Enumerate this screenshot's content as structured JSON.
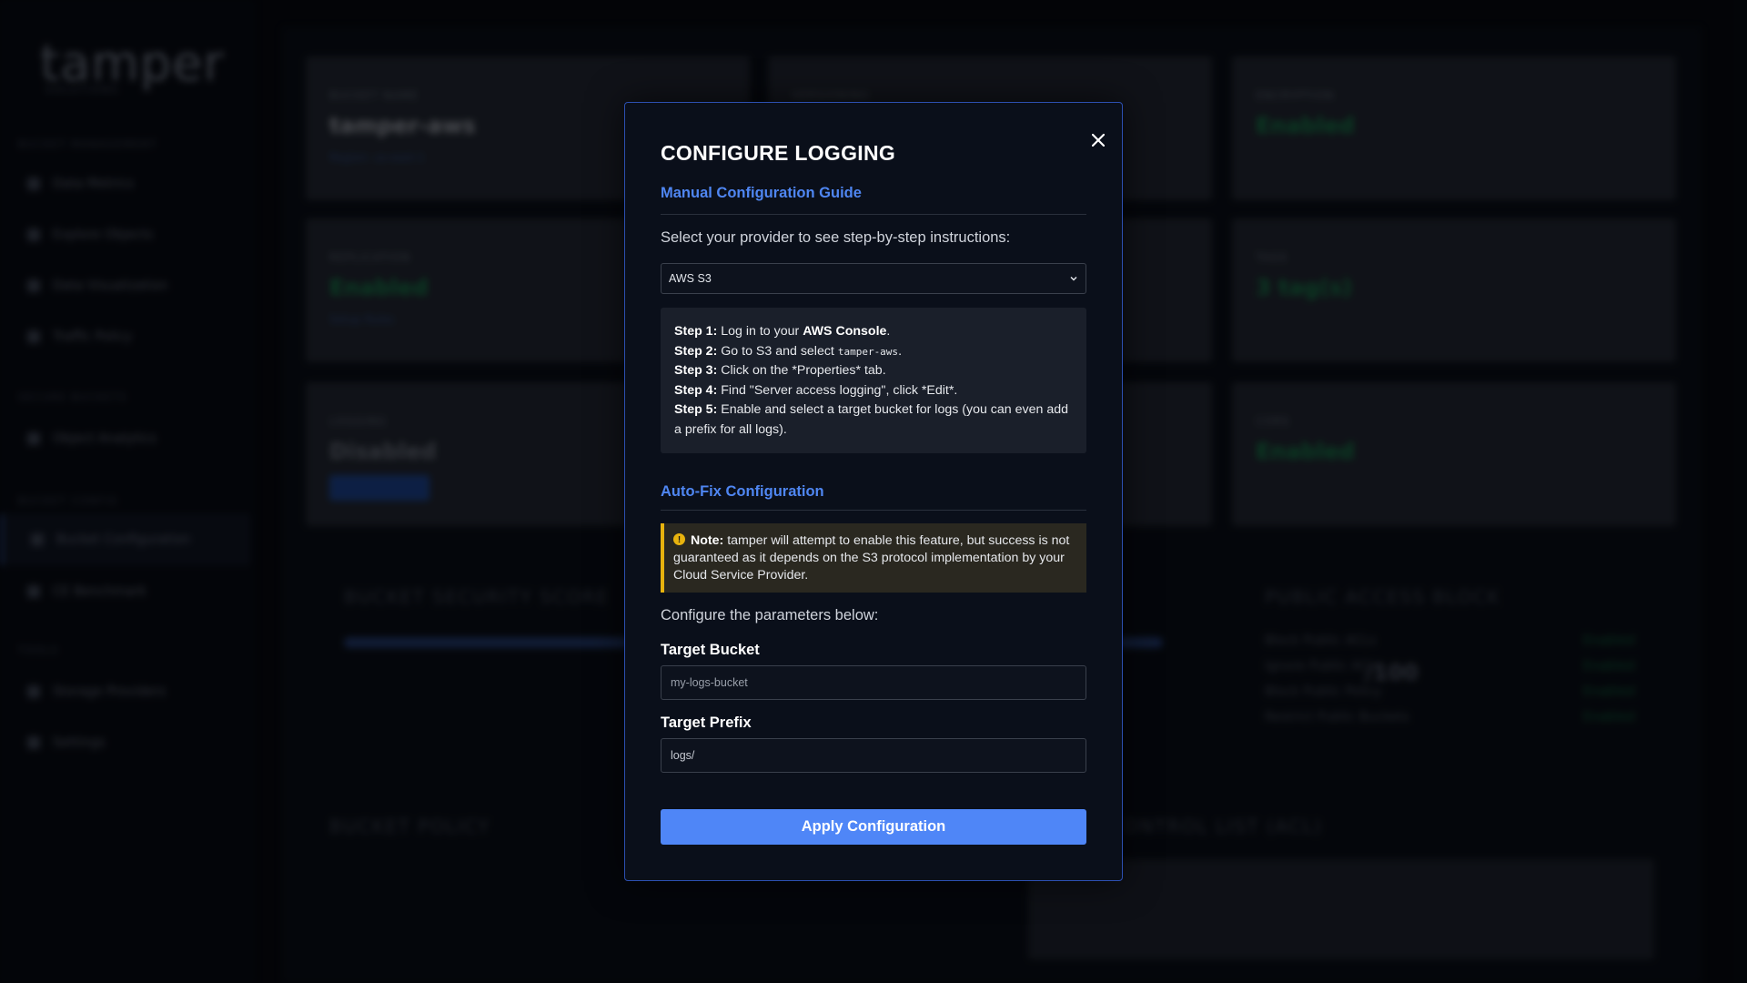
{
  "background": {
    "logo": "tamper",
    "logo_sub": "SOLUTIONS",
    "sidebar": {
      "groups": [
        "BUCKET MANAGEMENT",
        "SECURE BUCKETS",
        "BUCKET CONFIG",
        "TOOLS"
      ],
      "items": [
        "Data Metrics",
        "Explore Objects",
        "Data Visualization",
        "Traffic Policy",
        "Object Analytics",
        "Bucket Configuration",
        "CE Benchmark",
        "Storage Providers",
        "Settings"
      ],
      "active_item": "Bucket Configuration"
    },
    "cards": [
      {
        "label": "BUCKET NAME",
        "value": "tamper-aws",
        "link": "Region: us-east-1"
      },
      {
        "label": "VERSIONING",
        "value": "",
        "link": ""
      },
      {
        "label": "ENCRYPTION",
        "value": "Enabled",
        "link": ""
      },
      {
        "label": "REPLICATION",
        "value": "Enabled",
        "link": "Setup Rules"
      },
      {
        "label": "",
        "value": "",
        "link": ""
      },
      {
        "label": "TAGS",
        "value": "3 tag(s)",
        "link": ""
      },
      {
        "label": "LOGGING",
        "value": "Disabled",
        "link": ""
      },
      {
        "label": "",
        "value": "",
        "link": ""
      },
      {
        "label": "CORS",
        "value": "Enabled",
        "link": ""
      }
    ],
    "score_title": "BUCKET SECURITY SCORE",
    "score_value": "/100",
    "pab_title": "PUBLIC ACCESS BLOCK",
    "pab_rows": [
      {
        "name": "Block Public ACLs",
        "status": "Enabled"
      },
      {
        "name": "Ignore Public ACLs",
        "status": "Enabled"
      },
      {
        "name": "Block Public Policy",
        "status": "Enabled"
      },
      {
        "name": "Restrict Public Buckets",
        "status": "Enabled"
      }
    ],
    "policy_title": "BUCKET POLICY",
    "acl_title": "CONTROL LIST (ACL)"
  },
  "modal": {
    "title": "CONFIGURE LOGGING",
    "close_icon": "close-icon",
    "manual_title": "Manual Configuration Guide",
    "provider_prompt": "Select your provider to see step-by-step instructions:",
    "provider_selected": "AWS S3",
    "steps": [
      {
        "label": "Step 1:",
        "text_before": "Log in to your ",
        "bold": "AWS Console",
        "text_after": "."
      },
      {
        "label": "Step 2:",
        "text_before": "Go to S3 and select ",
        "code": "tamper-aws",
        "text_after": "."
      },
      {
        "label": "Step 3:",
        "text": "Click on the *Properties* tab."
      },
      {
        "label": "Step 4:",
        "text": "Find \"Server access logging\", click *Edit*."
      },
      {
        "label": "Step 5:",
        "text": "Enable and select a target bucket for logs (you can even add a prefix for all logs)."
      }
    ],
    "autofix_title": "Auto-Fix Configuration",
    "note_label": "Note:",
    "note_text": "tamper will attempt to enable this feature, but success is not guaranteed as it depends on the S3 protocol implementation by your Cloud Service Provider.",
    "params_prompt": "Configure the parameters below:",
    "target_bucket_label": "Target Bucket",
    "target_bucket_placeholder": "my-logs-bucket",
    "target_prefix_label": "Target Prefix",
    "target_prefix_value": "logs/",
    "apply_label": "Apply Configuration",
    "colors": {
      "accent": "#4f86f7",
      "note_border": "#e8b30e",
      "modal_border": "#2c4fb0"
    }
  }
}
